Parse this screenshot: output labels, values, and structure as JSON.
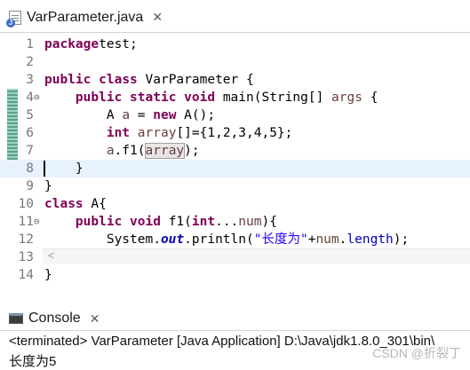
{
  "editor_tab": {
    "title": "VarParameter.java",
    "close": "✕",
    "icon": "java-file-icon"
  },
  "editor": {
    "lines": [
      {
        "n": "1",
        "fold": "",
        "tokens": [
          [
            "kw",
            "package"
          ],
          [
            "",
            "test;"
          ]
        ]
      },
      {
        "n": "2",
        "fold": "",
        "tokens": []
      },
      {
        "n": "3",
        "fold": "",
        "tokens": [
          [
            "kw",
            "public"
          ],
          [
            "",
            " "
          ],
          [
            "kw",
            "class"
          ],
          [
            "",
            " VarParameter {"
          ]
        ]
      },
      {
        "n": "4",
        "fold": "⊖",
        "tokens": [
          [
            "",
            "    "
          ],
          [
            "kw",
            "public"
          ],
          [
            "",
            " "
          ],
          [
            "kw",
            "static"
          ],
          [
            "",
            " "
          ],
          [
            "kw",
            "void"
          ],
          [
            "",
            " main(String[] "
          ],
          [
            "var",
            "args"
          ],
          [
            "",
            " {"
          ]
        ]
      },
      {
        "n": "5",
        "fold": "",
        "tokens": [
          [
            "",
            "        A "
          ],
          [
            "var",
            "a"
          ],
          [
            "",
            " = "
          ],
          [
            "kw",
            "new"
          ],
          [
            "",
            " A();"
          ]
        ]
      },
      {
        "n": "6",
        "fold": "",
        "tokens": [
          [
            "",
            "        "
          ],
          [
            "kw",
            "int"
          ],
          [
            "",
            " "
          ],
          [
            "var",
            "array"
          ],
          [
            "",
            "[]={1,2,3,4,5};"
          ]
        ]
      },
      {
        "n": "7",
        "fold": "",
        "tokens": [
          [
            "",
            "        "
          ],
          [
            "var",
            "a"
          ],
          [
            "",
            ".f1("
          ],
          [
            "var occ",
            "array"
          ],
          [
            "",
            ");"
          ]
        ]
      },
      {
        "n": "8",
        "fold": "",
        "tokens": [
          [
            "",
            "    }"
          ]
        ]
      },
      {
        "n": "9",
        "fold": "",
        "tokens": [
          [
            "",
            "}"
          ]
        ]
      },
      {
        "n": "10",
        "fold": "",
        "tokens": [
          [
            "kw",
            "class"
          ],
          [
            "",
            " A{"
          ]
        ]
      },
      {
        "n": "11",
        "fold": "⊖",
        "tokens": [
          [
            "",
            "    "
          ],
          [
            "kw",
            "public"
          ],
          [
            "",
            " "
          ],
          [
            "kw",
            "void"
          ],
          [
            "",
            " f1("
          ],
          [
            "kw",
            "int"
          ],
          [
            "",
            "..."
          ],
          [
            "var",
            "num"
          ],
          [
            "",
            "){"
          ]
        ]
      },
      {
        "n": "12",
        "fold": "",
        "tokens": [
          [
            "",
            "        System."
          ],
          [
            "sfield",
            "out"
          ],
          [
            "",
            ".println("
          ],
          [
            "str",
            "\"长度为\""
          ],
          [
            "",
            "+"
          ],
          [
            "var",
            "num"
          ],
          [
            "",
            "."
          ],
          [
            "field",
            "length"
          ],
          [
            "",
            ");"
          ]
        ]
      },
      {
        "n": "13",
        "fold": "",
        "tokens": [
          [
            "",
            "    }"
          ]
        ]
      },
      {
        "n": "14",
        "fold": "",
        "tokens": [
          [
            "",
            "}"
          ]
        ]
      }
    ],
    "current_line": "8",
    "scroll_left": "<"
  },
  "console": {
    "tab_title": "Console",
    "close": "✕",
    "icon": "console-icon",
    "status_line": "<terminated> VarParameter [Java Application] D:\\Java\\jdk1.8.0_301\\bin\\",
    "output": "长度为5"
  },
  "watermark": "CSDN @折裂丁"
}
